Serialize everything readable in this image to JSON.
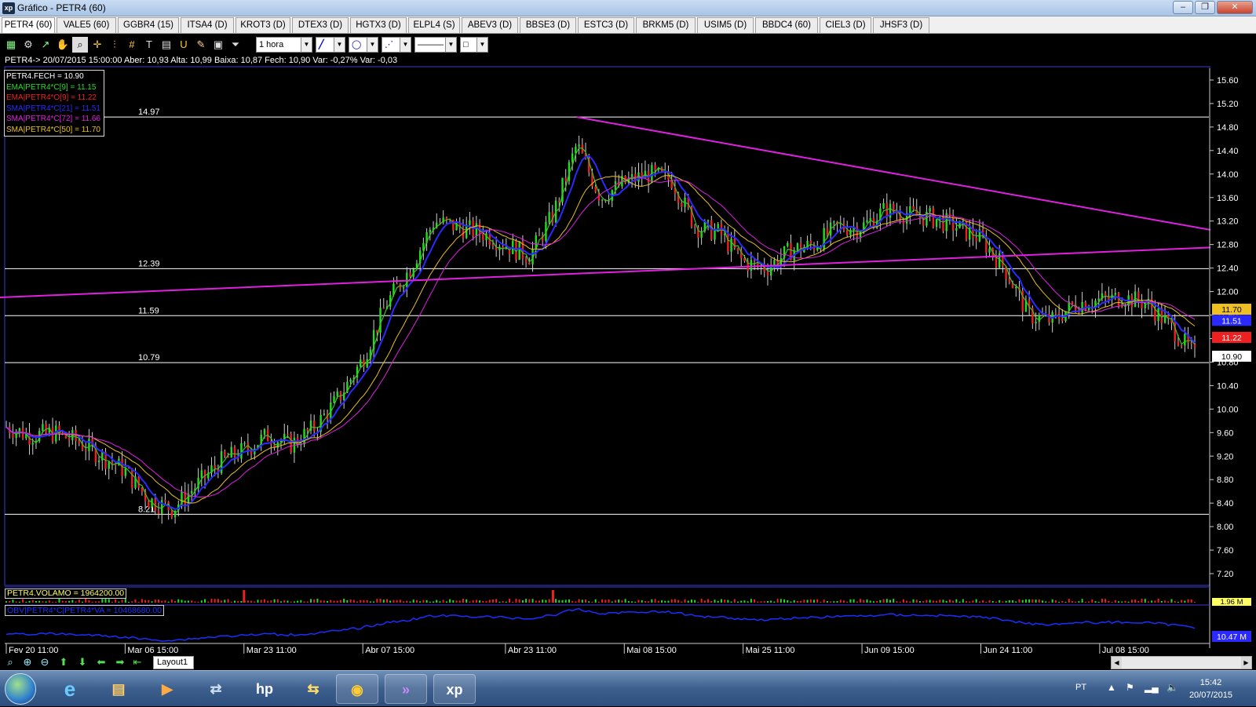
{
  "window": {
    "title": "Gráfico - PETR4 (60)",
    "app_icon": "xp",
    "buttons": [
      "minimize-icon",
      "maximize-icon",
      "close-icon"
    ]
  },
  "tabs": [
    {
      "label": "PETR4 (60)",
      "active": true
    },
    {
      "label": "VALE5 (60)"
    },
    {
      "label": "GGBR4 (15)"
    },
    {
      "label": "ITSA4 (D)"
    },
    {
      "label": "KROT3 (D)"
    },
    {
      "label": "DTEX3 (D)"
    },
    {
      "label": "HGTX3 (D)"
    },
    {
      "label": "ELPL4 (S)"
    },
    {
      "label": "ABEV3 (D)"
    },
    {
      "label": "BBSE3 (D)"
    },
    {
      "label": "ESTC3 (D)"
    },
    {
      "label": "BRKM5 (D)"
    },
    {
      "label": "USIM5 (D)"
    },
    {
      "label": "BBDC4 (60)"
    },
    {
      "label": "CIEL3 (D)"
    },
    {
      "label": "JHSF3 (D)"
    }
  ],
  "toolbar": {
    "period_select": "1 hora",
    "tools": [
      "chart-type-icon",
      "settings-gear-icon",
      "indicator-icon",
      "hand-pan-icon",
      "magnifier-icon",
      "crosshair-icon",
      "horizontal-lines-icon",
      "grid-icon",
      "text-tool-icon",
      "calculator-icon",
      "magnet-icon",
      "brush-icon",
      "briefcase-icon",
      "filter-icon"
    ],
    "drawing_tools": [
      "line-tool-icon",
      "ellipse-tool-icon",
      "fibonacci-tool-icon",
      "line-style-icon",
      "color-picker-icon"
    ]
  },
  "quote": {
    "text": "PETR4-> 20/07/2015 15:00:00 Aber: 10,93 Alta: 10,99 Baixa: 10,87 Fech: 10,90 Var: -0,27% Var: -0,03"
  },
  "legend": [
    {
      "label": "PETR4.FECH = 10.90",
      "color": "#ffffff"
    },
    {
      "label": "EMA|PETR4*C[9] = 11.15",
      "color": "#22dd22"
    },
    {
      "label": "EMA|PETR4*O[9] = 11.22",
      "color": "#ee2020"
    },
    {
      "label": "SMA|PETR4*C[21] = 11.51",
      "color": "#2a2aff"
    },
    {
      "label": "SMA|PETR4*C[72] = 11.66",
      "color": "#e020e0"
    },
    {
      "label": "SMA|PETR4*C[50] = 11.70",
      "color": "#e8c020"
    }
  ],
  "chart_data": {
    "type": "candlestick",
    "symbol": "PETR4",
    "timeframe": "1 hora",
    "ylim": [
      7.0,
      15.8
    ],
    "y_ticks": [
      "15.60",
      "15.20",
      "14.80",
      "14.40",
      "14.00",
      "13.60",
      "13.20",
      "12.80",
      "12.40",
      "12.00",
      "11.60",
      "11.20",
      "10.80",
      "10.40",
      "10.00",
      "9.60",
      "9.20",
      "8.80",
      "8.40",
      "8.00",
      "7.60",
      "7.20"
    ],
    "x_ticks": [
      "Fev 20 11:00",
      "Mar 06 15:00",
      "Mar 23 11:00",
      "Abr 07 15:00",
      "Abr 23 11:00",
      "Mai 08 15:00",
      "Mai 25 11:00",
      "Jun 09 15:00",
      "Jun 24 11:00",
      "Jul 08 15:00"
    ],
    "horizontal_levels": [
      14.97,
      12.39,
      11.59,
      10.79,
      8.21
    ],
    "trendlines": [
      {
        "from": {
          "x": "Mai 01",
          "y": 14.97
        },
        "to": {
          "x": "Jul 20",
          "y": 13.05
        },
        "color": "#e020e0"
      },
      {
        "from": {
          "x": "Abr 22",
          "y": 11.9
        },
        "to": {
          "x": "Jul 20",
          "y": 12.75
        },
        "color": "#e020e0"
      }
    ],
    "close_path": [
      [
        "Fev 20 11:00",
        9.7
      ],
      [
        "Fev 24",
        9.55
      ],
      [
        "Fev 26",
        9.6
      ],
      [
        "Mar 02",
        9.45
      ],
      [
        "Mar 04",
        9.2
      ],
      [
        "Mar 06 15:00",
        8.95
      ],
      [
        "Mar 10",
        8.45
      ],
      [
        "Mar 12",
        8.3
      ],
      [
        "Mar 16",
        8.7
      ],
      [
        "Mar 18",
        9.1
      ],
      [
        "Mar 23 11:00",
        9.3
      ],
      [
        "Mar 25",
        9.55
      ],
      [
        "Mar 27",
        9.4
      ],
      [
        "Mar 31",
        9.7
      ],
      [
        "Abr 02",
        10.2
      ],
      [
        "Abr 07 15:00",
        10.85
      ],
      [
        "Abr 09",
        11.8
      ],
      [
        "Abr 13",
        12.4
      ],
      [
        "Abr 15",
        13.2
      ],
      [
        "Abr 17",
        13.1
      ],
      [
        "Abr 20",
        13.0
      ],
      [
        "Abr 23 11:00",
        12.8
      ],
      [
        "Abr 27",
        12.6
      ],
      [
        "Abr 29",
        13.3
      ],
      [
        "Mai 01",
        14.5
      ],
      [
        "Mai 05",
        13.6
      ],
      [
        "Mai 08 15:00",
        13.85
      ],
      [
        "Mai 12",
        14.0
      ],
      [
        "Mai 14",
        13.9
      ],
      [
        "Mai 18",
        13.1
      ],
      [
        "Mai 20",
        13.0
      ],
      [
        "Mai 25 11:00",
        12.5
      ],
      [
        "Mai 27",
        12.4
      ],
      [
        "Mai 29",
        12.7
      ],
      [
        "Jun 02",
        12.8
      ],
      [
        "Jun 05",
        13.1
      ],
      [
        "Jun 09 15:00",
        13.1
      ],
      [
        "Jun 11",
        13.4
      ],
      [
        "Jun 15",
        13.3
      ],
      [
        "Jun 17",
        13.25
      ],
      [
        "Jun 19",
        13.1
      ],
      [
        "Jun 24 11:00",
        12.9
      ],
      [
        "Jun 26",
        12.4
      ],
      [
        "Jun 30",
        11.6
      ],
      [
        "Jul 02",
        11.5
      ],
      [
        "Jul 06",
        11.8
      ],
      [
        "Jul 08 15:00",
        11.85
      ],
      [
        "Jul 10",
        11.9
      ],
      [
        "Jul 14",
        11.8
      ],
      [
        "Jul 17",
        11.4
      ],
      [
        "Jul 20",
        10.9
      ]
    ],
    "price_tags": [
      {
        "label": "11.70",
        "value": 11.7,
        "bg": "#f0c020",
        "fg": "#000000"
      },
      {
        "label": "11.51",
        "value": 11.51,
        "bg": "#2a2aff",
        "fg": "#ffffff"
      },
      {
        "label": "11.22",
        "value": 11.22,
        "bg": "#ee2020",
        "fg": "#ffffff"
      },
      {
        "label": "10.90",
        "value": 10.9,
        "bg": "#ffffff",
        "fg": "#000000"
      }
    ],
    "volume": {
      "label": "PETR4.VOLAMO = 1964200.00",
      "axis_tag": "1.96 M",
      "spikes": [
        {
          "x": "Mar 23 11:00",
          "color": "#ee2020"
        },
        {
          "x": "Abr 29",
          "color": "#ee2020"
        }
      ]
    },
    "obv": {
      "label": "OBV|PETR4*C|PETR4*VA = 10468680.00",
      "axis_tag": "10.47 M"
    }
  },
  "bottom": {
    "layout_tab": "Layout1",
    "nav_icons": [
      "zoom-icon",
      "zoom-in-icon",
      "zoom-out-icon",
      "arrow-up-icon",
      "arrow-down-icon",
      "arrow-left-icon",
      "arrow-right-icon",
      "arrow-end-icon"
    ]
  },
  "taskbar": {
    "apps": [
      "start-orb-icon",
      "internet-explorer-icon",
      "file-explorer-icon",
      "media-player-icon",
      "network-app-icon",
      "hp-icon",
      "folder-sync-icon",
      "chrome-icon",
      "arrow-app-icon",
      "xp-app-icon"
    ],
    "lang": "PT",
    "time": "15:42",
    "date": "20/07/2015"
  }
}
